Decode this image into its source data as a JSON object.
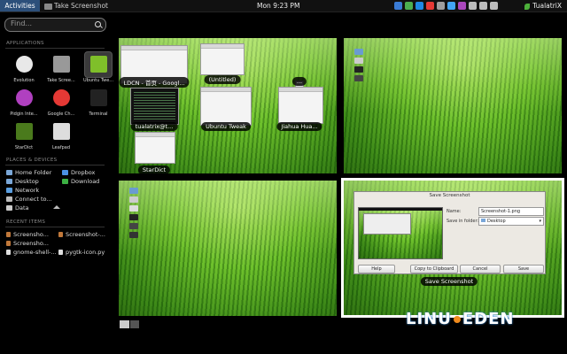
{
  "topbar": {
    "activities": "Activities",
    "app_menu": "Take Screenshot",
    "clock": "Mon  9:23 PM",
    "user": "TualatriX",
    "tray_colors": [
      "#3a7bd5",
      "#4caf50",
      "#1e88e5",
      "#e53935",
      "#9e9e9e",
      "#42a5f5",
      "#ab47bc",
      "#bbb",
      "#bbb",
      "#bbb"
    ]
  },
  "search": {
    "placeholder": "Find..."
  },
  "sections": {
    "applications": "APPLICATIONS",
    "places": "PLACES & DEVICES",
    "recent": "RECENT ITEMS"
  },
  "apps": [
    {
      "label": "Evolution",
      "icon": "clock-icon",
      "color": "#e8e8e8"
    },
    {
      "label": "Take Scree...",
      "icon": "camera-icon",
      "color": "#999"
    },
    {
      "label": "Ubuntu Twe...",
      "icon": "tweak-icon",
      "color": "#7fbf2a"
    },
    {
      "label": "Pidgin Inte...",
      "icon": "pidgin-icon",
      "color": "#b040c0"
    },
    {
      "label": "Google Ch...",
      "icon": "chrome-icon",
      "color": "#e53935"
    },
    {
      "label": "Terminal",
      "icon": "terminal-icon",
      "color": "#222"
    },
    {
      "label": "StarDict",
      "icon": "book-icon",
      "color": "#4a7a1c"
    },
    {
      "label": "Leafpad",
      "icon": "notepad-icon",
      "color": "#ddd"
    }
  ],
  "places": [
    {
      "label": "Home Folder",
      "color": "#7aa7d8"
    },
    {
      "label": "Dropbox",
      "color": "#4a90e2"
    },
    {
      "label": "Desktop",
      "color": "#7aa7d8"
    },
    {
      "label": "Download",
      "color": "#3cb043"
    },
    {
      "label": "Network",
      "color": "#5a9ee0"
    },
    {
      "label": "Connect to...",
      "color": "#bbb"
    },
    {
      "label": "Data",
      "color": "#ccc"
    }
  ],
  "recent": [
    {
      "label": "Screensho...",
      "color": "#c0783a"
    },
    {
      "label": "Screenshot-...",
      "color": "#c0783a"
    },
    {
      "label": "Screensho...",
      "color": "#c0783a"
    },
    {
      "label": "gnome-shell-...",
      "color": "#ddd"
    },
    {
      "label": "pygtk-icon.py",
      "color": "#ddd"
    }
  ],
  "workspace1": {
    "windows": [
      {
        "caption": "LDCN - 首页 - Googl..."
      },
      {
        "caption": "(Untitled)"
      },
      {
        "caption": "..."
      },
      {
        "caption": "tualatrix@t..."
      },
      {
        "caption": "Ubuntu Tweak"
      },
      {
        "caption": "Jiahua Hua..."
      },
      {
        "caption": "StarDict"
      }
    ]
  },
  "workspace4": {
    "caption": "Save Screenshot",
    "dialog": {
      "title": "Save Screenshot",
      "name_label": "Name:",
      "name_value": "Screenshot-1.png",
      "folder_label": "Save in folder:",
      "folder_value": "Desktop",
      "buttons": [
        "Help",
        "Copy to Clipboard",
        "Cancel",
        "Save"
      ]
    }
  },
  "watermark": {
    "left": "LINU",
    "right": "EDEN"
  }
}
